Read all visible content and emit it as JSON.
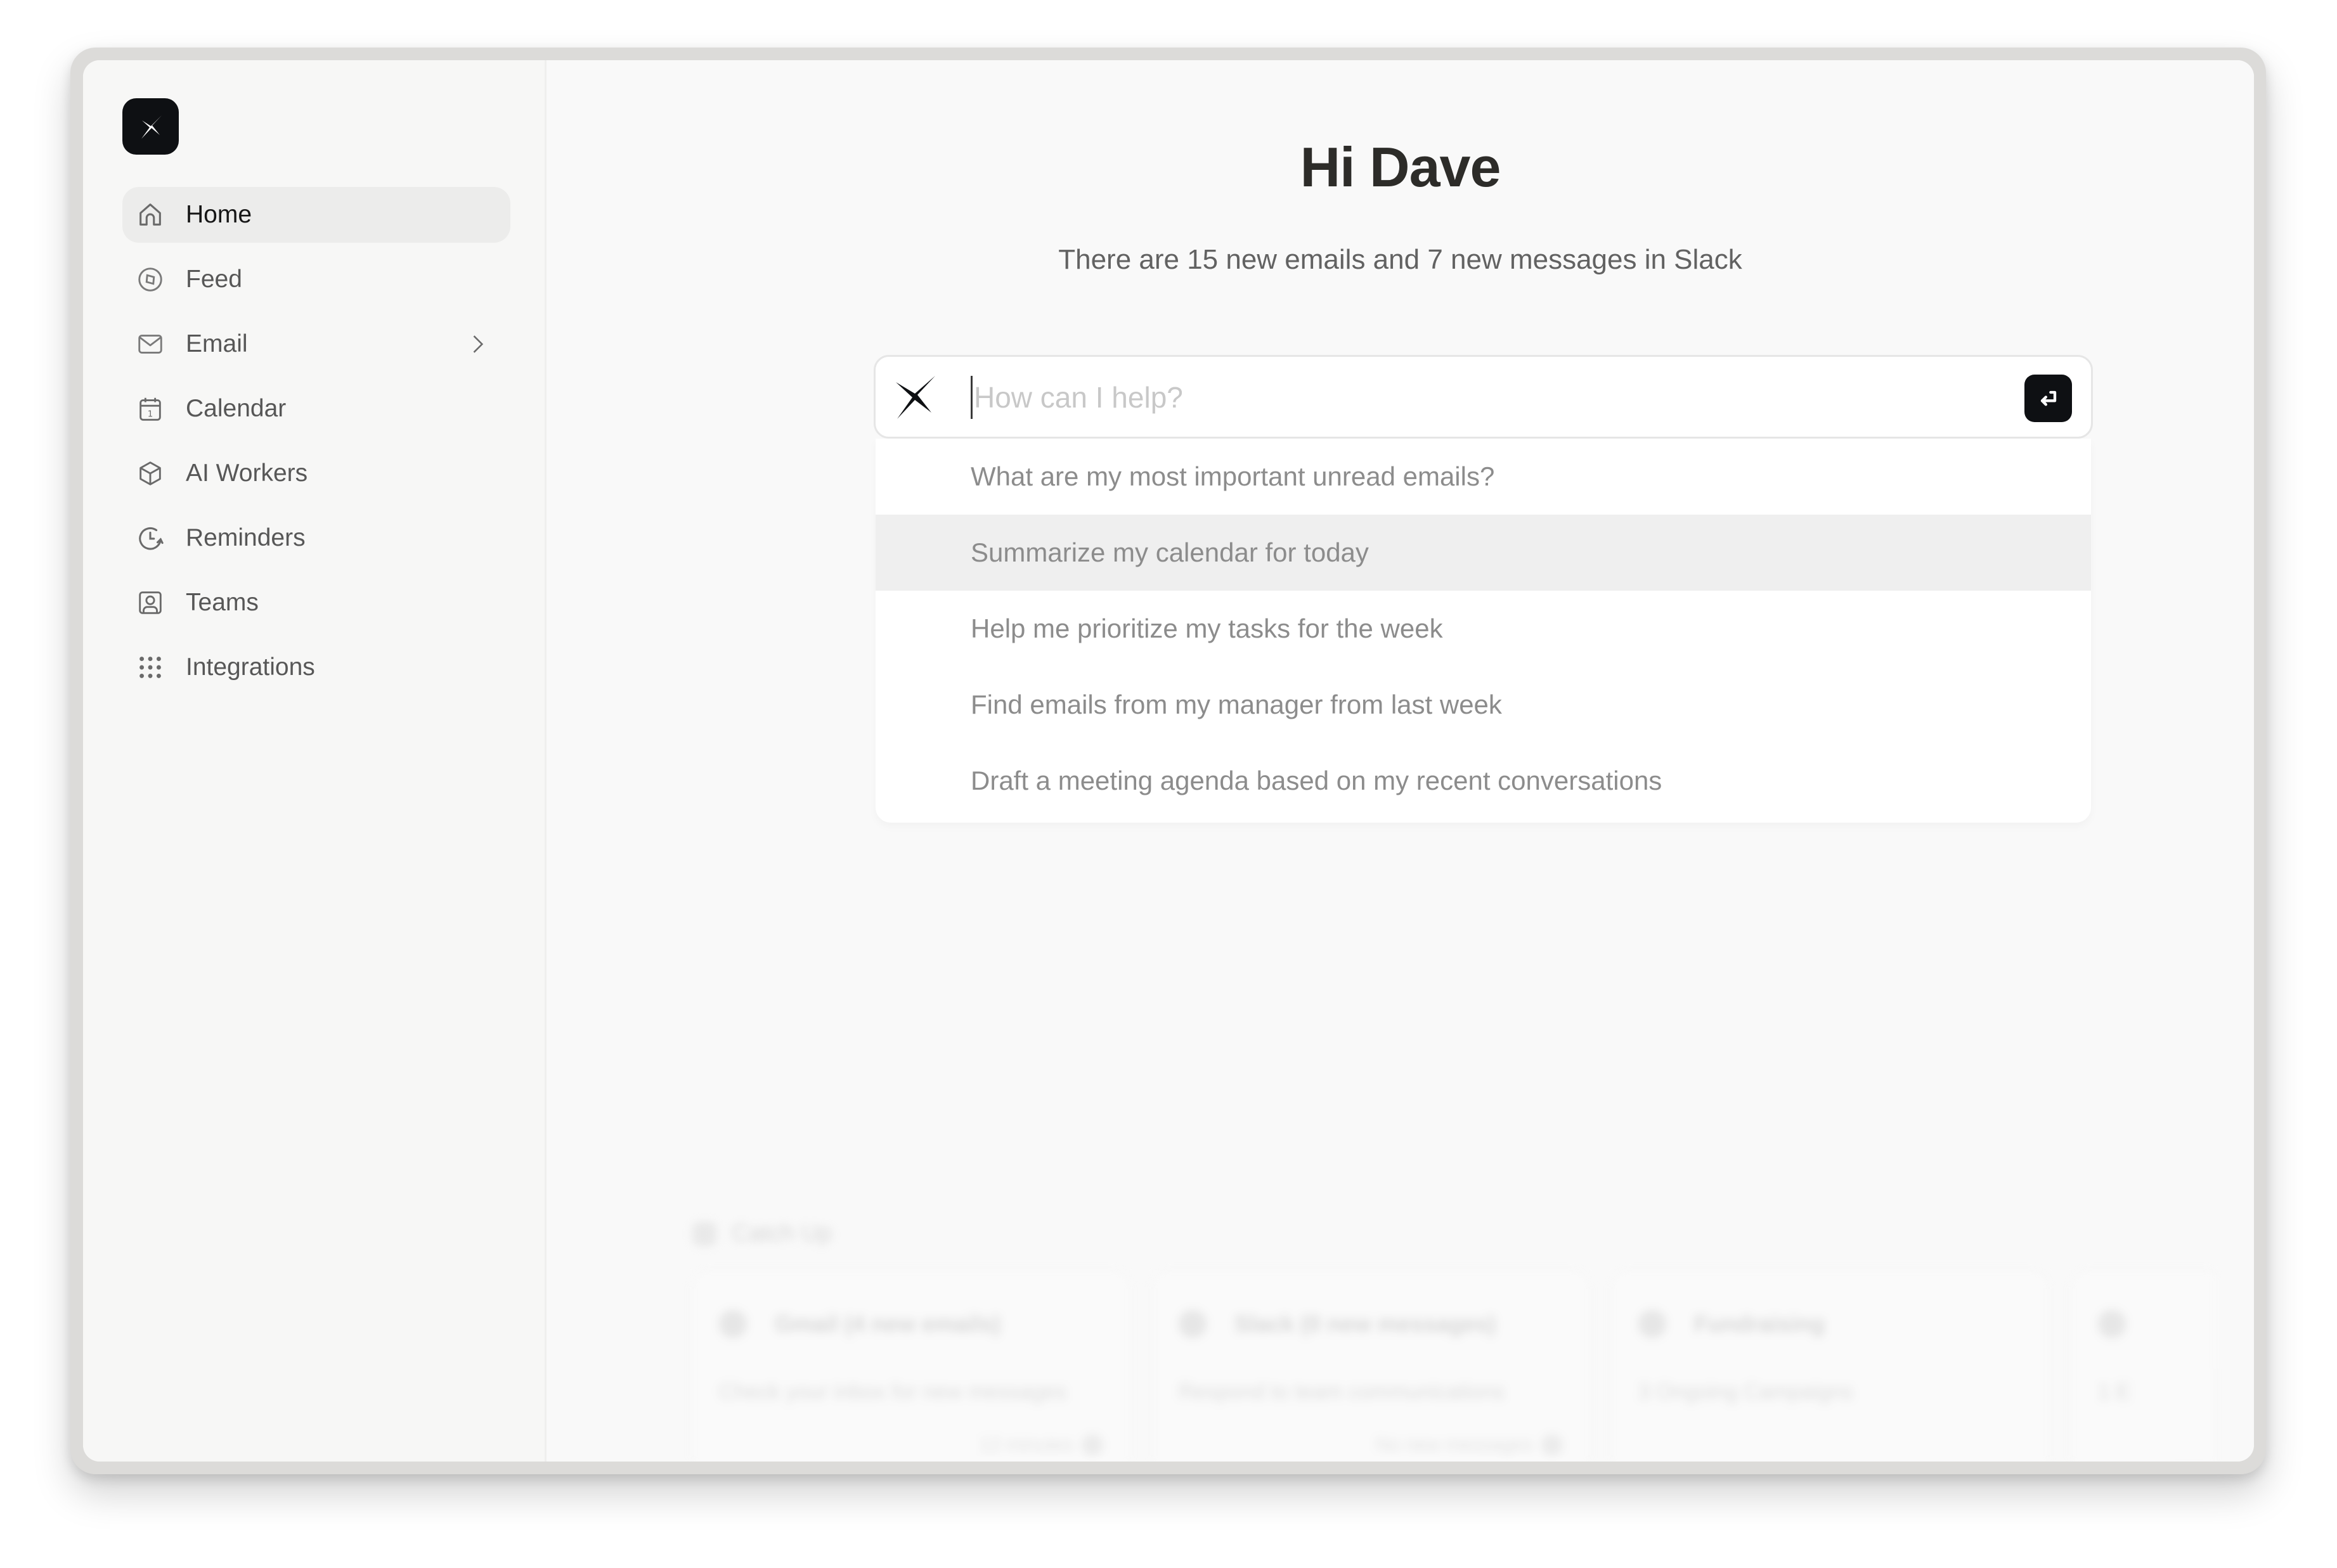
{
  "sidebar": {
    "logo": "spark-logo",
    "items": [
      {
        "label": "Home",
        "icon": "home-icon",
        "active": true
      },
      {
        "label": "Feed",
        "icon": "compass-icon"
      },
      {
        "label": "Email",
        "icon": "mail-icon",
        "has_submenu": true
      },
      {
        "label": "Calendar",
        "icon": "calendar-icon"
      },
      {
        "label": "AI Workers",
        "icon": "cube-icon"
      },
      {
        "label": "Reminders",
        "icon": "clock-refresh-icon"
      },
      {
        "label": "Teams",
        "icon": "user-square-icon"
      },
      {
        "label": "Integrations",
        "icon": "grid-dots-icon"
      }
    ]
  },
  "main": {
    "greeting": "Hi Dave",
    "subtitle": "There are 15 new emails and 7 new messages in Slack",
    "composer": {
      "placeholder": "How can I help?",
      "value": "",
      "send_icon": "enter-return-icon"
    },
    "suggestions": [
      "What are my most important unread emails?",
      "Summarize my calendar for today",
      "Help me prioritize my tasks for the week",
      "Find emails from my manager from last week",
      "Draft a meeting agenda based on my recent conversations"
    ],
    "highlighted_suggestion": 1,
    "catch_up": {
      "title": "Catch Up",
      "cards": [
        {
          "title": "Gmail (4 new emails)",
          "description": "Check your inbox for new messages",
          "meta": "12 minutes"
        },
        {
          "title": "Slack (0 new messages)",
          "description": "Respond to team communications",
          "meta": "No new messages"
        },
        {
          "title": "Fundraising",
          "description": "3 Ongoing Campaigns",
          "meta": ""
        },
        {
          "title": "",
          "description": "1 E",
          "meta": ""
        }
      ]
    }
  },
  "colors": {
    "accent_dark": "#0e1013",
    "sidebar_bg": "#f7f7f6",
    "active_item_bg": "#ececeb",
    "suggestion_highlight": "#efefef"
  }
}
